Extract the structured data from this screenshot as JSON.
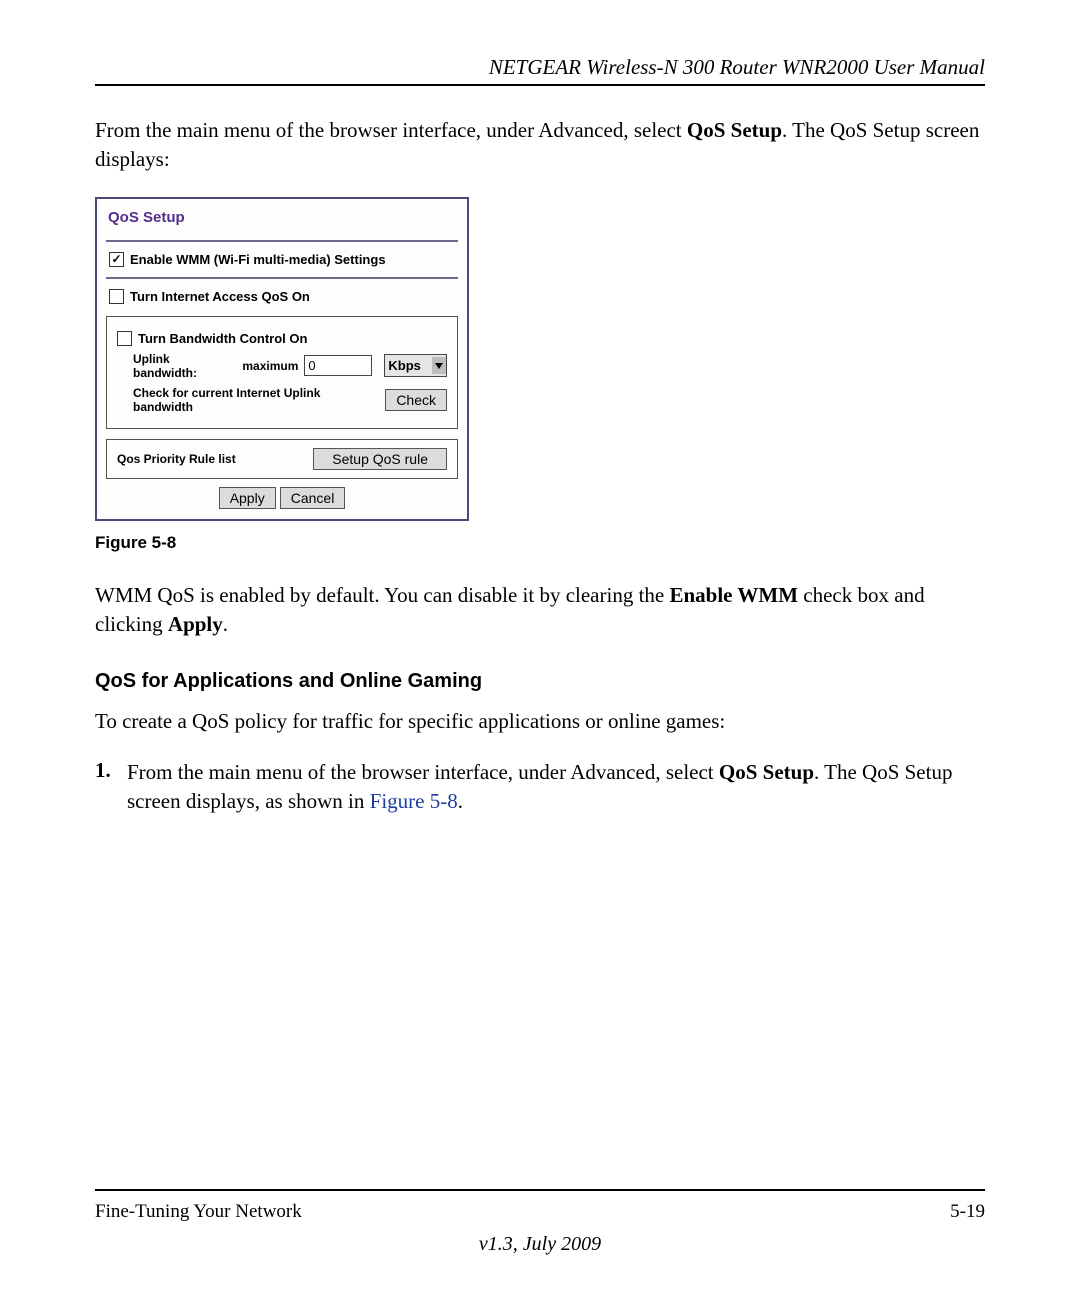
{
  "header": {
    "title": "NETGEAR Wireless-N 300 Router WNR2000 User Manual"
  },
  "intro": {
    "text_before_bold": "From the main menu of the browser interface, under Advanced, select ",
    "bold": "QoS Setup",
    "text_after_bold": ". The QoS Setup screen displays:"
  },
  "figure": {
    "panel_title": "QoS Setup",
    "enable_wmm_label": "Enable WMM (Wi-Fi multi-media) Settings",
    "enable_wmm_checked": true,
    "internet_qos_label": "Turn Internet Access QoS On",
    "internet_qos_checked": false,
    "bandwidth_control_label": "Turn Bandwidth Control On",
    "bandwidth_control_checked": false,
    "uplink_label_a": "Uplink bandwidth:",
    "uplink_label_b": "maximum",
    "uplink_value": "0",
    "uplink_unit": "Kbps",
    "check_label": "Check for current Internet Uplink bandwidth",
    "check_button": "Check",
    "priority_label": "Qos Priority Rule list",
    "setup_button": "Setup QoS rule",
    "apply_button": "Apply",
    "cancel_button": "Cancel",
    "caption": "Figure 5-8"
  },
  "wmm_paragraph": {
    "part1": "WMM QoS is enabled by default. You can disable it by clearing the ",
    "bold1": "Enable WMM",
    "part2": " check box and clicking ",
    "bold2": "Apply",
    "part3": "."
  },
  "section": {
    "heading": "QoS for Applications and Online Gaming",
    "intro": "To create a QoS policy for traffic for specific applications or online games:",
    "step1_num": "1.",
    "step1_a": "From the main menu of the browser interface, under Advanced, select ",
    "step1_bold": "QoS Setup",
    "step1_b": ". The QoS Setup screen displays, as shown in ",
    "step1_link": "Figure 5-8",
    "step1_c": "."
  },
  "footer": {
    "left": "Fine-Tuning Your Network",
    "right": "5-19",
    "version": "v1.3, July 2009"
  }
}
